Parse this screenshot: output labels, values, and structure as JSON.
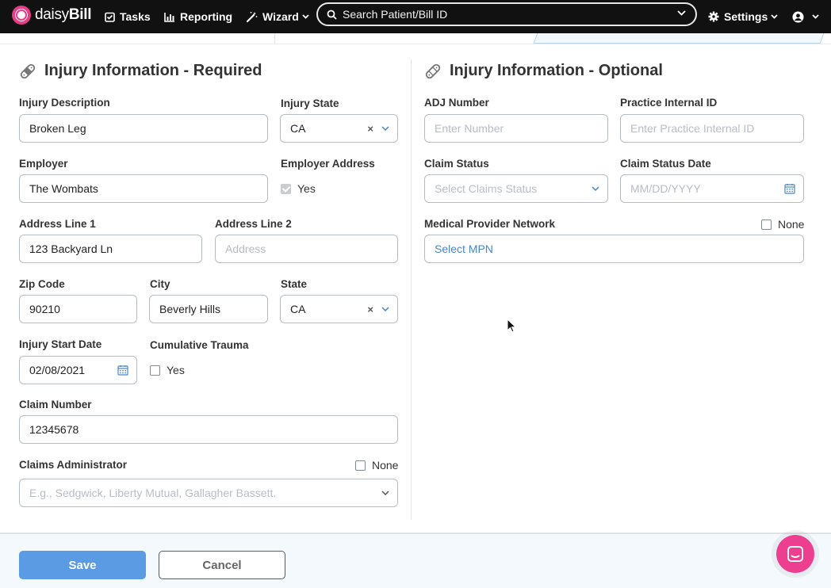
{
  "nav": {
    "logo_light": "daisy",
    "logo_bold": "Bill",
    "tasks": "Tasks",
    "reporting": "Reporting",
    "wizard": "Wizard",
    "search_placeholder": "Search Patient/Bill ID",
    "settings": "Settings"
  },
  "left": {
    "title": "Injury Information - Required",
    "injury_description_label": "Injury Description",
    "injury_description_value": "Broken Leg",
    "injury_state_label": "Injury State",
    "injury_state_value": "CA",
    "employer_label": "Employer",
    "employer_value": "The Wombats",
    "employer_address_label": "Employer Address",
    "employer_address_option": "Yes",
    "address1_label": "Address Line 1",
    "address1_value": "123 Backyard Ln",
    "address2_label": "Address Line 2",
    "address2_placeholder": "Address",
    "zip_label": "Zip Code",
    "zip_value": "90210",
    "city_label": "City",
    "city_value": "Beverly Hills",
    "state_label": "State",
    "state_value": "CA",
    "injury_start_label": "Injury Start Date",
    "injury_start_value": "02/08/2021",
    "cumulative_label": "Cumulative Trauma",
    "cumulative_option": "Yes",
    "claim_number_label": "Claim Number",
    "claim_number_value": "12345678",
    "claims_admin_label": "Claims Administrator",
    "claims_admin_none": "None",
    "claims_admin_placeholder": "E.g., Sedgwick, Liberty Mutual, Gallagher Bassett."
  },
  "right": {
    "title": "Injury Information - Optional",
    "adj_label": "ADJ Number",
    "adj_placeholder": "Enter Number",
    "practice_id_label": "Practice Internal ID",
    "practice_id_placeholder": "Enter Practice Internal ID",
    "claim_status_label": "Claim Status",
    "claim_status_placeholder": "Select Claims Status",
    "claim_status_date_label": "Claim Status Date",
    "claim_status_date_placeholder": "MM/DD/YYYY",
    "mpn_label": "Medical Provider Network",
    "mpn_none": "None",
    "mpn_placeholder": "Select MPN"
  },
  "footer": {
    "save": "Save",
    "cancel": "Cancel"
  },
  "colors": {
    "nav_bg": "#111111",
    "brand_pink": "#e63f86",
    "save_blue": "#5b9be3"
  }
}
